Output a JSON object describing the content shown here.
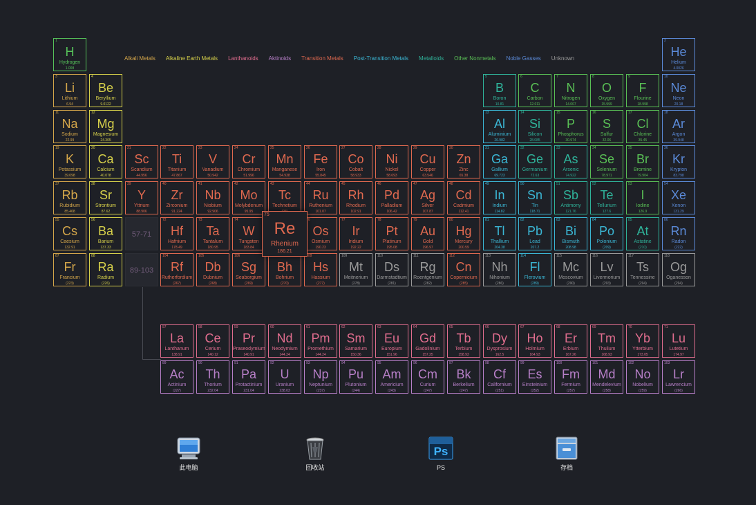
{
  "legend": [
    "Alkali Metals",
    "Alkaline Earth Metals",
    "Lanthanoids",
    "Aktinoids",
    "Transition Metals",
    "Post-Transition Metals",
    "Metalloids",
    "Other Nonmetals",
    "Noble Gasses",
    "Unknown"
  ],
  "category_colors": {
    "alkali": "#d4a64a",
    "alkaline": "#d6d04a",
    "lanth": "#e06d8e",
    "actin": "#b77fc8",
    "trans": "#e0694f",
    "post": "#3bb6d4",
    "metalloid": "#2fb39a",
    "nonmetal": "#59bf55",
    "noble": "#5b8ad8",
    "unknown": "#9a9a9a",
    "hydrogen": "#56c25a"
  },
  "placeholders": [
    "57-71",
    "89-103"
  ],
  "selected_element": "Re",
  "elements": [
    {
      "n": "1",
      "s": "H",
      "name": "Hydrogen",
      "m": "1.008",
      "c": "hydrogen",
      "r": 1,
      "col": 1
    },
    {
      "n": "2",
      "s": "He",
      "name": "Helium",
      "m": "4.0026",
      "c": "noble",
      "r": 1,
      "col": 18
    },
    {
      "n": "3",
      "s": "Li",
      "name": "Lithium",
      "m": "6.94",
      "c": "alkali",
      "r": 2,
      "col": 1
    },
    {
      "n": "4",
      "s": "Be",
      "name": "Beryllium",
      "m": "9.0122",
      "c": "alkaline",
      "r": 2,
      "col": 2
    },
    {
      "n": "5",
      "s": "B",
      "name": "Boron",
      "m": "10.81",
      "c": "metalloid",
      "r": 2,
      "col": 13
    },
    {
      "n": "6",
      "s": "C",
      "name": "Carbon",
      "m": "12.011",
      "c": "nonmetal",
      "r": 2,
      "col": 14
    },
    {
      "n": "7",
      "s": "N",
      "name": "Nitrogen",
      "m": "14.007",
      "c": "nonmetal",
      "r": 2,
      "col": 15
    },
    {
      "n": "8",
      "s": "O",
      "name": "Oxygen",
      "m": "15.999",
      "c": "nonmetal",
      "r": 2,
      "col": 16
    },
    {
      "n": "9",
      "s": "F",
      "name": "Flourine",
      "m": "18.998",
      "c": "nonmetal",
      "r": 2,
      "col": 17
    },
    {
      "n": "10",
      "s": "Ne",
      "name": "Neon",
      "m": "20.18",
      "c": "noble",
      "r": 2,
      "col": 18
    },
    {
      "n": "11",
      "s": "Na",
      "name": "Sodium",
      "m": "22.99",
      "c": "alkali",
      "r": 3,
      "col": 1
    },
    {
      "n": "12",
      "s": "Mg",
      "name": "Magnesium",
      "m": "24.305",
      "c": "alkaline",
      "r": 3,
      "col": 2
    },
    {
      "n": "13",
      "s": "Al",
      "name": "Aluminium",
      "m": "26.982",
      "c": "post",
      "r": 3,
      "col": 13
    },
    {
      "n": "14",
      "s": "Si",
      "name": "Silicon",
      "m": "28.085",
      "c": "metalloid",
      "r": 3,
      "col": 14
    },
    {
      "n": "15",
      "s": "P",
      "name": "Phosphorus",
      "m": "30.974",
      "c": "nonmetal",
      "r": 3,
      "col": 15
    },
    {
      "n": "16",
      "s": "S",
      "name": "Sulfur",
      "m": "32.06",
      "c": "nonmetal",
      "r": 3,
      "col": 16
    },
    {
      "n": "17",
      "s": "Cl",
      "name": "Chlorine",
      "m": "35.45",
      "c": "nonmetal",
      "r": 3,
      "col": 17
    },
    {
      "n": "18",
      "s": "Ar",
      "name": "Argon",
      "m": "39.948",
      "c": "noble",
      "r": 3,
      "col": 18
    },
    {
      "n": "19",
      "s": "K",
      "name": "Potassium",
      "m": "39.098",
      "c": "alkali",
      "r": 4,
      "col": 1
    },
    {
      "n": "20",
      "s": "Ca",
      "name": "Calcium",
      "m": "40.078",
      "c": "alkaline",
      "r": 4,
      "col": 2
    },
    {
      "n": "21",
      "s": "Sc",
      "name": "Scandium",
      "m": "44.956",
      "c": "trans",
      "r": 4,
      "col": 3
    },
    {
      "n": "22",
      "s": "Ti",
      "name": "Titanium",
      "m": "47.867",
      "c": "trans",
      "r": 4,
      "col": 4
    },
    {
      "n": "23",
      "s": "V",
      "name": "Vanadium",
      "m": "50.942",
      "c": "trans",
      "r": 4,
      "col": 5
    },
    {
      "n": "24",
      "s": "Cr",
      "name": "Chromium",
      "m": "51.996",
      "c": "trans",
      "r": 4,
      "col": 6
    },
    {
      "n": "25",
      "s": "Mn",
      "name": "Manganese",
      "m": "54.938",
      "c": "trans",
      "r": 4,
      "col": 7
    },
    {
      "n": "26",
      "s": "Fe",
      "name": "Iron",
      "m": "55.845",
      "c": "trans",
      "r": 4,
      "col": 8
    },
    {
      "n": "27",
      "s": "Co",
      "name": "Cobalt",
      "m": "58.933",
      "c": "trans",
      "r": 4,
      "col": 9
    },
    {
      "n": "28",
      "s": "Ni",
      "name": "Nickel",
      "m": "58.693",
      "c": "trans",
      "r": 4,
      "col": 10
    },
    {
      "n": "29",
      "s": "Cu",
      "name": "Copper",
      "m": "63.546",
      "c": "trans",
      "r": 4,
      "col": 11
    },
    {
      "n": "30",
      "s": "Zn",
      "name": "Zinc",
      "m": "65.38",
      "c": "trans",
      "r": 4,
      "col": 12
    },
    {
      "n": "31",
      "s": "Ga",
      "name": "Gallium",
      "m": "69.723",
      "c": "post",
      "r": 4,
      "col": 13
    },
    {
      "n": "32",
      "s": "Ge",
      "name": "Germanium",
      "m": "72.63",
      "c": "metalloid",
      "r": 4,
      "col": 14
    },
    {
      "n": "33",
      "s": "As",
      "name": "Arsenic",
      "m": "74.922",
      "c": "metalloid",
      "r": 4,
      "col": 15
    },
    {
      "n": "34",
      "s": "Se",
      "name": "Selenium",
      "m": "78.971",
      "c": "nonmetal",
      "r": 4,
      "col": 16
    },
    {
      "n": "35",
      "s": "Br",
      "name": "Bromine",
      "m": "79.904",
      "c": "nonmetal",
      "r": 4,
      "col": 17
    },
    {
      "n": "36",
      "s": "Kr",
      "name": "Krypton",
      "m": "83.798",
      "c": "noble",
      "r": 4,
      "col": 18
    },
    {
      "n": "37",
      "s": "Rb",
      "name": "Rubidium",
      "m": "85.468",
      "c": "alkali",
      "r": 5,
      "col": 1
    },
    {
      "n": "38",
      "s": "Sr",
      "name": "Strontium",
      "m": "87.62",
      "c": "alkaline",
      "r": 5,
      "col": 2
    },
    {
      "n": "39",
      "s": "Y",
      "name": "Yttrium",
      "m": "88.906",
      "c": "trans",
      "r": 5,
      "col": 3
    },
    {
      "n": "40",
      "s": "Zr",
      "name": "Zirconium",
      "m": "91.224",
      "c": "trans",
      "r": 5,
      "col": 4
    },
    {
      "n": "41",
      "s": "Nb",
      "name": "Niobium",
      "m": "92.906",
      "c": "trans",
      "r": 5,
      "col": 5
    },
    {
      "n": "42",
      "s": "Mo",
      "name": "Molybdenum",
      "m": "95.95",
      "c": "trans",
      "r": 5,
      "col": 6
    },
    {
      "n": "43",
      "s": "Tc",
      "name": "Technetium",
      "m": "(98)",
      "c": "trans",
      "r": 5,
      "col": 7
    },
    {
      "n": "44",
      "s": "Ru",
      "name": "Ruthenium",
      "m": "101.07",
      "c": "trans",
      "r": 5,
      "col": 8
    },
    {
      "n": "45",
      "s": "Rh",
      "name": "Rhodium",
      "m": "102.91",
      "c": "trans",
      "r": 5,
      "col": 9
    },
    {
      "n": "46",
      "s": "Pd",
      "name": "Palladium",
      "m": "106.42",
      "c": "trans",
      "r": 5,
      "col": 10
    },
    {
      "n": "47",
      "s": "Ag",
      "name": "Silver",
      "m": "107.87",
      "c": "trans",
      "r": 5,
      "col": 11
    },
    {
      "n": "48",
      "s": "Cd",
      "name": "Cadmium",
      "m": "112.41",
      "c": "trans",
      "r": 5,
      "col": 12
    },
    {
      "n": "49",
      "s": "In",
      "name": "Indium",
      "m": "114.82",
      "c": "post",
      "r": 5,
      "col": 13
    },
    {
      "n": "50",
      "s": "Sn",
      "name": "Tin",
      "m": "118.71",
      "c": "post",
      "r": 5,
      "col": 14
    },
    {
      "n": "51",
      "s": "Sb",
      "name": "Antimony",
      "m": "121.76",
      "c": "metalloid",
      "r": 5,
      "col": 15
    },
    {
      "n": "52",
      "s": "Te",
      "name": "Tellurium",
      "m": "127.6",
      "c": "metalloid",
      "r": 5,
      "col": 16
    },
    {
      "n": "53",
      "s": "I",
      "name": "Iodine",
      "m": "126.9",
      "c": "nonmetal",
      "r": 5,
      "col": 17
    },
    {
      "n": "54",
      "s": "Xe",
      "name": "Xenon",
      "m": "131.29",
      "c": "noble",
      "r": 5,
      "col": 18
    },
    {
      "n": "55",
      "s": "Cs",
      "name": "Caesium",
      "m": "132.91",
      "c": "alkali",
      "r": 6,
      "col": 1
    },
    {
      "n": "56",
      "s": "Ba",
      "name": "Barium",
      "m": "137.33",
      "c": "alkaline",
      "r": 6,
      "col": 2
    },
    {
      "n": "72",
      "s": "Hf",
      "name": "Hafnium",
      "m": "178.49",
      "c": "trans",
      "r": 6,
      "col": 4
    },
    {
      "n": "73",
      "s": "Ta",
      "name": "Tantalum",
      "m": "180.95",
      "c": "trans",
      "r": 6,
      "col": 5
    },
    {
      "n": "74",
      "s": "W",
      "name": "Tungsten",
      "m": "183.84",
      "c": "trans",
      "r": 6,
      "col": 6
    },
    {
      "n": "75",
      "s": "Re",
      "name": "Rhenium",
      "m": "186.21",
      "c": "trans",
      "r": 6,
      "col": 7
    },
    {
      "n": "76",
      "s": "Os",
      "name": "Osmium",
      "m": "190.23",
      "c": "trans",
      "r": 6,
      "col": 8
    },
    {
      "n": "77",
      "s": "Ir",
      "name": "Iridium",
      "m": "192.22",
      "c": "trans",
      "r": 6,
      "col": 9
    },
    {
      "n": "78",
      "s": "Pt",
      "name": "Platinum",
      "m": "195.08",
      "c": "trans",
      "r": 6,
      "col": 10
    },
    {
      "n": "79",
      "s": "Au",
      "name": "Gold",
      "m": "196.97",
      "c": "trans",
      "r": 6,
      "col": 11
    },
    {
      "n": "80",
      "s": "Hg",
      "name": "Mercury",
      "m": "200.59",
      "c": "trans",
      "r": 6,
      "col": 12
    },
    {
      "n": "81",
      "s": "Tl",
      "name": "Thallium",
      "m": "204.38",
      "c": "post",
      "r": 6,
      "col": 13
    },
    {
      "n": "82",
      "s": "Pb",
      "name": "Lead",
      "m": "207.2",
      "c": "post",
      "r": 6,
      "col": 14
    },
    {
      "n": "83",
      "s": "Bi",
      "name": "Bismuth",
      "m": "208.98",
      "c": "post",
      "r": 6,
      "col": 15
    },
    {
      "n": "84",
      "s": "Po",
      "name": "Polonium",
      "m": "(209)",
      "c": "post",
      "r": 6,
      "col": 16
    },
    {
      "n": "85",
      "s": "At",
      "name": "Astatine",
      "m": "(210)",
      "c": "metalloid",
      "r": 6,
      "col": 17
    },
    {
      "n": "86",
      "s": "Rn",
      "name": "Radon",
      "m": "(222)",
      "c": "noble",
      "r": 6,
      "col": 18
    },
    {
      "n": "87",
      "s": "Fr",
      "name": "Francium",
      "m": "(223)",
      "c": "alkali",
      "r": 7,
      "col": 1
    },
    {
      "n": "88",
      "s": "Ra",
      "name": "Radium",
      "m": "(226)",
      "c": "alkaline",
      "r": 7,
      "col": 2
    },
    {
      "n": "104",
      "s": "Rf",
      "name": "Rutherfordium",
      "m": "(267)",
      "c": "trans",
      "r": 7,
      "col": 4
    },
    {
      "n": "105",
      "s": "Db",
      "name": "Dubnium",
      "m": "(268)",
      "c": "trans",
      "r": 7,
      "col": 5
    },
    {
      "n": "106",
      "s": "Sg",
      "name": "Seaborgium",
      "m": "(269)",
      "c": "trans",
      "r": 7,
      "col": 6
    },
    {
      "n": "107",
      "s": "Bh",
      "name": "Bohrium",
      "m": "(270)",
      "c": "trans",
      "r": 7,
      "col": 7
    },
    {
      "n": "108",
      "s": "Hs",
      "name": "Hassium",
      "m": "(277)",
      "c": "trans",
      "r": 7,
      "col": 8
    },
    {
      "n": "109",
      "s": "Mt",
      "name": "Meitnerium",
      "m": "(278)",
      "c": "unknown",
      "r": 7,
      "col": 9
    },
    {
      "n": "110",
      "s": "Ds",
      "name": "Darmstadtium",
      "m": "(281)",
      "c": "unknown",
      "r": 7,
      "col": 10
    },
    {
      "n": "111",
      "s": "Rg",
      "name": "Roentgenium",
      "m": "(282)",
      "c": "unknown",
      "r": 7,
      "col": 11
    },
    {
      "n": "112",
      "s": "Cn",
      "name": "Copernicium",
      "m": "(285)",
      "c": "trans",
      "r": 7,
      "col": 12
    },
    {
      "n": "113",
      "s": "Nh",
      "name": "Nihonium",
      "m": "(286)",
      "c": "unknown",
      "r": 7,
      "col": 13
    },
    {
      "n": "114",
      "s": "Fl",
      "name": "Flerovium",
      "m": "(289)",
      "c": "post",
      "r": 7,
      "col": 14
    },
    {
      "n": "115",
      "s": "Mc",
      "name": "Moscovium",
      "m": "(290)",
      "c": "unknown",
      "r": 7,
      "col": 15
    },
    {
      "n": "116",
      "s": "Lv",
      "name": "Livermorium",
      "m": "(293)",
      "c": "unknown",
      "r": 7,
      "col": 16
    },
    {
      "n": "117",
      "s": "Ts",
      "name": "Tennessine",
      "m": "(294)",
      "c": "unknown",
      "r": 7,
      "col": 17
    },
    {
      "n": "118",
      "s": "Og",
      "name": "Oganesson",
      "m": "(294)",
      "c": "unknown",
      "r": 7,
      "col": 18
    },
    {
      "n": "57",
      "s": "La",
      "name": "Lanthanum",
      "m": "138.91",
      "c": "lanth",
      "r": 9,
      "col": 4
    },
    {
      "n": "58",
      "s": "Ce",
      "name": "Cerium",
      "m": "140.12",
      "c": "lanth",
      "r": 9,
      "col": 5
    },
    {
      "n": "59",
      "s": "Pr",
      "name": "Praseodymium",
      "m": "140.91",
      "c": "lanth",
      "r": 9,
      "col": 6
    },
    {
      "n": "60",
      "s": "Nd",
      "name": "Neodymium",
      "m": "144.24",
      "c": "lanth",
      "r": 9,
      "col": 7
    },
    {
      "n": "61",
      "s": "Pm",
      "name": "Promethium",
      "m": "144.24",
      "c": "lanth",
      "r": 9,
      "col": 8
    },
    {
      "n": "62",
      "s": "Sm",
      "name": "Samarium",
      "m": "150.36",
      "c": "lanth",
      "r": 9,
      "col": 9
    },
    {
      "n": "63",
      "s": "Eu",
      "name": "Europium",
      "m": "151.96",
      "c": "lanth",
      "r": 9,
      "col": 10
    },
    {
      "n": "64",
      "s": "Gd",
      "name": "Gadolinium",
      "m": "157.25",
      "c": "lanth",
      "r": 9,
      "col": 11
    },
    {
      "n": "65",
      "s": "Tb",
      "name": "Terbium",
      "m": "158.93",
      "c": "lanth",
      "r": 9,
      "col": 12
    },
    {
      "n": "66",
      "s": "Dy",
      "name": "Dysprosium",
      "m": "162.5",
      "c": "lanth",
      "r": 9,
      "col": 13
    },
    {
      "n": "67",
      "s": "Ho",
      "name": "Holmium",
      "m": "164.93",
      "c": "lanth",
      "r": 9,
      "col": 14
    },
    {
      "n": "68",
      "s": "Er",
      "name": "Erbium",
      "m": "167.26",
      "c": "lanth",
      "r": 9,
      "col": 15
    },
    {
      "n": "69",
      "s": "Tm",
      "name": "Thulium",
      "m": "168.93",
      "c": "lanth",
      "r": 9,
      "col": 16
    },
    {
      "n": "70",
      "s": "Yb",
      "name": "Ytterbium",
      "m": "173.05",
      "c": "lanth",
      "r": 9,
      "col": 17
    },
    {
      "n": "71",
      "s": "Lu",
      "name": "Lutetium",
      "m": "174.97",
      "c": "lanth",
      "r": 9,
      "col": 18
    },
    {
      "n": "89",
      "s": "Ac",
      "name": "Actinium",
      "m": "(227)",
      "c": "actin",
      "r": 10,
      "col": 4
    },
    {
      "n": "90",
      "s": "Th",
      "name": "Thorium",
      "m": "232.04",
      "c": "actin",
      "r": 10,
      "col": 5
    },
    {
      "n": "91",
      "s": "Pa",
      "name": "Protactinium",
      "m": "231.04",
      "c": "actin",
      "r": 10,
      "col": 6
    },
    {
      "n": "92",
      "s": "U",
      "name": "Uranium",
      "m": "238.03",
      "c": "actin",
      "r": 10,
      "col": 7
    },
    {
      "n": "93",
      "s": "Np",
      "name": "Neptunium",
      "m": "(237)",
      "c": "actin",
      "r": 10,
      "col": 8
    },
    {
      "n": "94",
      "s": "Pu",
      "name": "Plutonium",
      "m": "(244)",
      "c": "actin",
      "r": 10,
      "col": 9
    },
    {
      "n": "95",
      "s": "Am",
      "name": "Americium",
      "m": "(243)",
      "c": "actin",
      "r": 10,
      "col": 10
    },
    {
      "n": "96",
      "s": "Cm",
      "name": "Curium",
      "m": "(247)",
      "c": "actin",
      "r": 10,
      "col": 11
    },
    {
      "n": "97",
      "s": "Bk",
      "name": "Berkelium",
      "m": "(247)",
      "c": "actin",
      "r": 10,
      "col": 12
    },
    {
      "n": "98",
      "s": "Cf",
      "name": "Californium",
      "m": "(251)",
      "c": "actin",
      "r": 10,
      "col": 13
    },
    {
      "n": "99",
      "s": "Es",
      "name": "Einsteinium",
      "m": "(252)",
      "c": "actin",
      "r": 10,
      "col": 14
    },
    {
      "n": "100",
      "s": "Fm",
      "name": "Fermium",
      "m": "(257)",
      "c": "actin",
      "r": 10,
      "col": 15
    },
    {
      "n": "101",
      "s": "Md",
      "name": "Mendelevium",
      "m": "(258)",
      "c": "actin",
      "r": 10,
      "col": 16
    },
    {
      "n": "102",
      "s": "No",
      "name": "Nobelium",
      "m": "(259)",
      "c": "actin",
      "r": 10,
      "col": 17
    },
    {
      "n": "103",
      "s": "Lr",
      "name": "Lawrencium",
      "m": "(266)",
      "c": "actin",
      "r": 10,
      "col": 18
    }
  ],
  "desktop": [
    {
      "label": "此电脑",
      "icon": "computer-icon"
    },
    {
      "label": "回收站",
      "icon": "recycle-bin-icon"
    },
    {
      "label": "PS",
      "icon": "photoshop-icon"
    },
    {
      "label": "存档",
      "icon": "archive-folder-icon"
    }
  ]
}
